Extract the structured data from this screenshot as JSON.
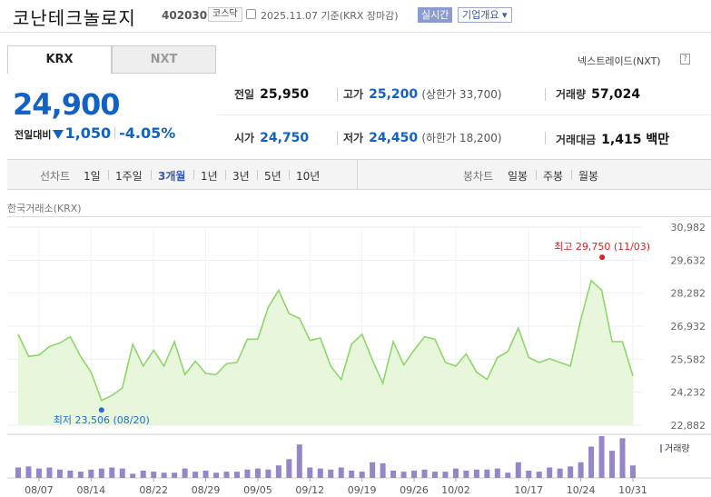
{
  "header": {
    "name": "코난테크놀로지",
    "code": "402030",
    "market": "코스닥",
    "date": "2025.11.07 기준(KRX 장마감)",
    "realtime": "실시간",
    "corp_info": "기업개요 ▾"
  },
  "tabs": {
    "krx": "KRX",
    "nxt": "NXT"
  },
  "nxt_link": "넥스트레이드(NXT)",
  "help_icon": "?",
  "quote": {
    "price": "24,900",
    "change_label": "전일대비",
    "change_value": "1,050",
    "change_rate": "-4.05%",
    "prev_label": "전일",
    "prev": "25,950",
    "high_label": "고가",
    "high": "25,200",
    "upper_limit": "(상한가 33,700)",
    "volume_label": "거래량",
    "volume": "57,024",
    "open_label": "시가",
    "open": "24,750",
    "low_label": "저가",
    "low": "24,450",
    "lower_limit": "(하한가 18,200)",
    "amount_label": "거래대금",
    "amount": "1,415 백만"
  },
  "periods": {
    "line_label": "선차트",
    "items": [
      "1일",
      "1주일",
      "3개월",
      "1년",
      "3년",
      "5년",
      "10년"
    ],
    "active": "3개월",
    "candle_label": "봉차트",
    "candle_items": [
      "일봉",
      "주봉",
      "월봉"
    ]
  },
  "chart_source": "한국거래소(KRX)",
  "colors": {
    "accent_blue": "#1261c4",
    "line_green": "#8ed66a",
    "fill_green": "#e8f6dc",
    "volume_purple": "#9785c9",
    "high_red": "#e02020"
  },
  "chart_data": {
    "type": "area",
    "yticks": [
      "30,982",
      "29,632",
      "28,282",
      "26,932",
      "25,582",
      "24,232",
      "22,882"
    ],
    "ylim": [
      22882,
      30982
    ],
    "xticks": [
      {
        "label": "08/07",
        "i": 2
      },
      {
        "label": "08/14",
        "i": 7
      },
      {
        "label": "08/22",
        "i": 13
      },
      {
        "label": "08/29",
        "i": 18
      },
      {
        "label": "09/05",
        "i": 23
      },
      {
        "label": "09/12",
        "i": 28
      },
      {
        "label": "09/19",
        "i": 33
      },
      {
        "label": "09/26",
        "i": 38
      },
      {
        "label": "10/02",
        "i": 42
      },
      {
        "label": "10/17",
        "i": 49
      },
      {
        "label": "10/24",
        "i": 54
      },
      {
        "label": "10/31",
        "i": 59
      }
    ],
    "prices": [
      26600,
      25700,
      25750,
      26100,
      26250,
      26500,
      25700,
      25050,
      23900,
      24100,
      24400,
      26200,
      25300,
      25950,
      25300,
      26300,
      24950,
      25500,
      25000,
      24950,
      25400,
      25450,
      26400,
      26400,
      27700,
      28400,
      27450,
      27250,
      26350,
      26450,
      25300,
      24750,
      26200,
      26600,
      25550,
      24600,
      26300,
      25350,
      25950,
      26500,
      26400,
      25450,
      25300,
      25800,
      25050,
      24750,
      25650,
      25900,
      26850,
      25650,
      25450,
      25600,
      25450,
      25300,
      27200,
      28800,
      28400,
      26300,
      26300,
      24900
    ],
    "volumes": [
      10,
      11,
      9,
      10,
      8,
      7,
      6,
      8,
      9,
      10,
      9,
      4,
      7,
      6,
      5,
      5,
      9,
      6,
      7,
      5,
      6,
      6,
      8,
      9,
      8,
      12,
      18,
      32,
      10,
      9,
      8,
      10,
      7,
      6,
      15,
      14,
      7,
      6,
      7,
      8,
      6,
      6,
      9,
      7,
      8,
      8,
      9,
      5,
      15,
      7,
      6,
      10,
      9,
      11,
      15,
      30,
      40,
      26,
      38,
      12
    ],
    "volume_label": "거래량",
    "high_annotation": "최고 29,750 (11/03)",
    "low_annotation": "최저 23,506 (08/20)",
    "high": {
      "i": 55,
      "value": 29750
    },
    "low": {
      "i": 8,
      "value": 23506
    }
  }
}
